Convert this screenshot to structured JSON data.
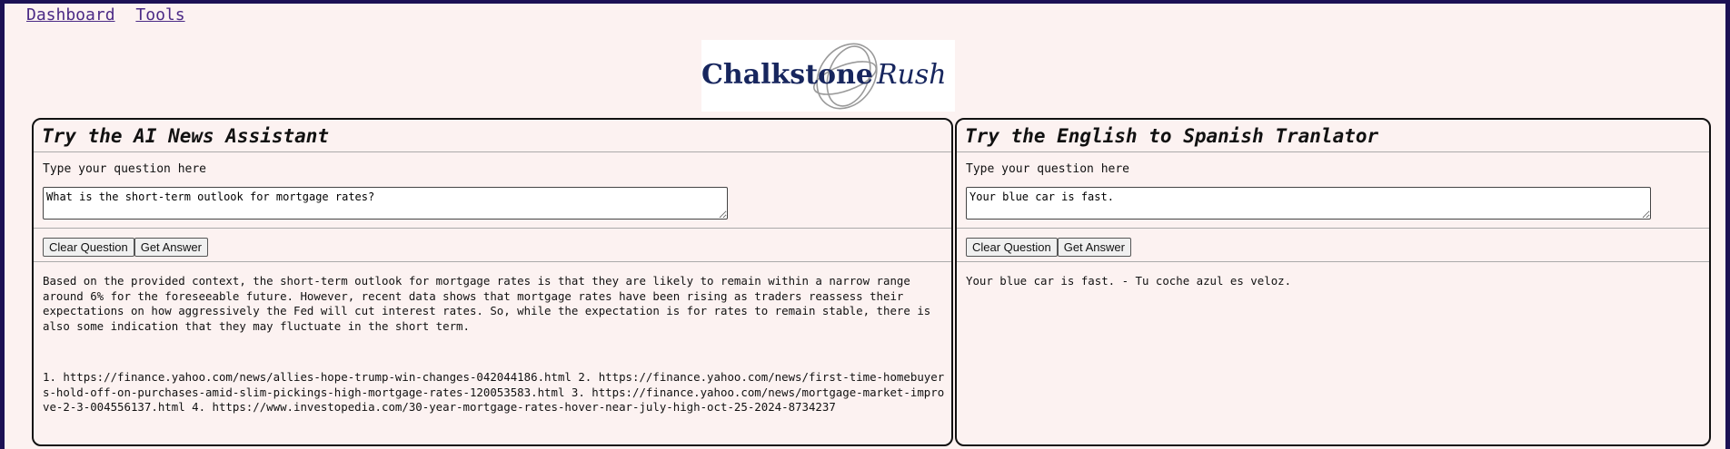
{
  "nav": {
    "dashboard": "Dashboard",
    "tools": "Tools"
  },
  "logo": {
    "text_main": "Chalkstone",
    "text_script": "Rush"
  },
  "news_assistant": {
    "title": "Try the AI News Assistant",
    "question_label": "Type your question here",
    "question_value": "What is the short-term outlook for mortgage rates?",
    "clear_label": "Clear Question",
    "get_label": "Get Answer",
    "answer": "Based on the provided context, the short-term outlook for mortgage rates is that they are likely to remain within a narrow range around 6% for the foreseeable future. However, recent data shows that mortgage rates have been rising as traders reassess their expectations on how aggressively the Fed will cut interest rates. So, while the expectation is for rates to remain stable, there is also some indication that they may fluctuate in the short term.",
    "sources": "1. https://finance.yahoo.com/news/allies-hope-trump-win-changes-042044186.html 2. https://finance.yahoo.com/news/first-time-homebuyers-hold-off-on-purchases-amid-slim-pickings-high-mortgage-rates-120053583.html 3. https://finance.yahoo.com/news/mortgage-market-improve-2-3-004556137.html 4. https://www.investopedia.com/30-year-mortgage-rates-hover-near-july-high-oct-25-2024-8734237"
  },
  "translator": {
    "title": "Try the English to Spanish Tranlator",
    "question_label": "Type your question here",
    "question_value": "Your blue car is fast.",
    "clear_label": "Clear Question",
    "get_label": "Get Answer",
    "answer": "Your blue car is fast. - Tu coche azul es veloz."
  },
  "colors": {
    "background": "#fcf2f1",
    "frame": "#1c1155",
    "link": "#4b2a86",
    "logo_navy": "#17265e"
  }
}
